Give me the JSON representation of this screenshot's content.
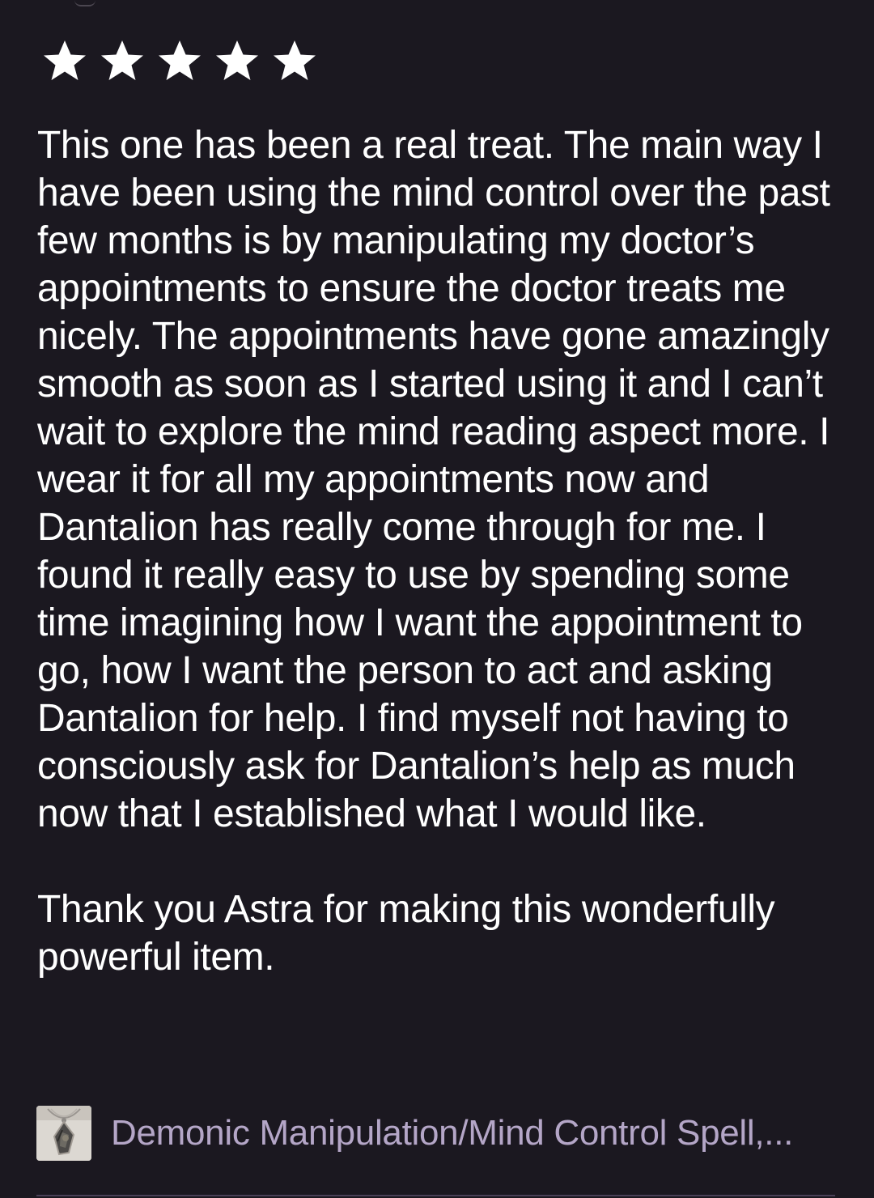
{
  "review": {
    "rating": 5,
    "rating_max": 5,
    "paragraph_1": "This one has been a real treat. The main way I have been using the mind control over the past few months is by manipulating my doctor’s appointments to ensure the doctor treats me nicely. The appointments have gone amazingly smooth as soon as I started using it and I can’t wait to explore the mind reading aspect more. I wear it for all my appointments now and Dantalion has really come through for me. I found it really easy to use by spending some time imagining how I want the appointment to go, how I want the person to act and asking Dantalion for help. I find myself not having to consciously ask for Dantalion’s help as much now that I established what I would like.",
    "paragraph_2": "Thank you Astra for making this wonderfully powerful item."
  },
  "product": {
    "title": "Demonic Manipulation/Mind Control Spell,...",
    "thumbnail_icon": "pendant-necklace-thumbnail"
  },
  "colors": {
    "background": "#1b1820",
    "text": "#ffffff",
    "star": "#ffffff",
    "product_title": "#b4a6c7"
  }
}
